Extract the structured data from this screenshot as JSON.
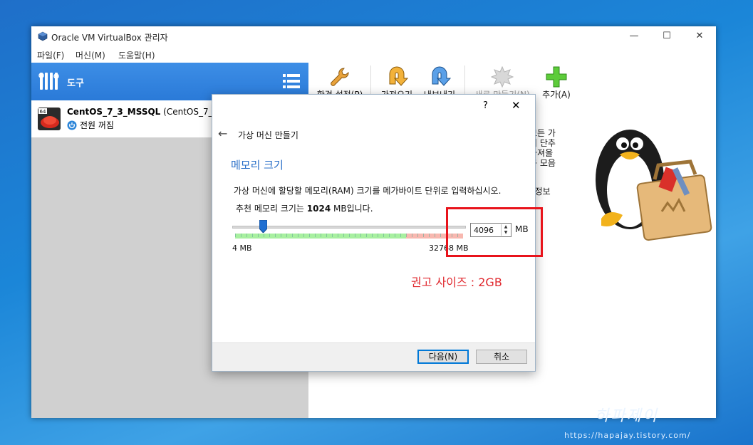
{
  "window": {
    "title": "Oracle VM VirtualBox 관리자",
    "controls": {
      "minimize": "—",
      "maximize": "☐",
      "close": "✕"
    }
  },
  "menu": [
    "파일(F)",
    "머신(M)",
    "도움말(H)"
  ],
  "sidebar": {
    "tools_label": "도구",
    "vm": {
      "name": "CentOS_7_3_MSSQL",
      "os_suffix": "(CentOS_7_",
      "state": "전원 꺼짐",
      "os_badge": "64"
    }
  },
  "toolbar": [
    {
      "label": "환경 설정(P)",
      "icon": "wrench-icon",
      "enabled": true
    },
    {
      "label": "가져오기",
      "icon": "import-icon",
      "enabled": true
    },
    {
      "label": "내보내기",
      "icon": "export-icon",
      "enabled": true
    },
    {
      "label": "새로 만들기(N)",
      "icon": "new-icon",
      "enabled": false
    },
    {
      "label": "추가(A)",
      "icon": "add-icon",
      "enabled": true
    }
  ],
  "background_text": [
    "모든 가",
    "의 단추",
    "가져올",
    "구 모음",
    "· 정보"
  ],
  "dialog": {
    "help": "?",
    "close": "✕",
    "title": "가상 머신 만들기",
    "section_title": "메모리 크기",
    "description": "가상 머신에 할당할 메모리(RAM) 크기를 메가바이트 단위로 입력하십시오.",
    "recommend_prefix": "추천 메모리 크기는 ",
    "recommend_value": "1024",
    "recommend_suffix": " MB입니다.",
    "memory_value": "4096",
    "memory_unit": "MB",
    "slider_min": "4 MB",
    "slider_max": "32768 MB",
    "slider_level_mb": 4096,
    "next_button": "다음(N)",
    "cancel_button": "취소"
  },
  "annotation": "권고 사이즈 : 2GB",
  "watermark": {
    "name": "하파제이",
    "url": "https://hapajay.tistory.com/"
  },
  "colors": {
    "accent_blue": "#2a7ad8",
    "highlight_red": "#e8131b",
    "section_blue": "#2a6fc8"
  }
}
